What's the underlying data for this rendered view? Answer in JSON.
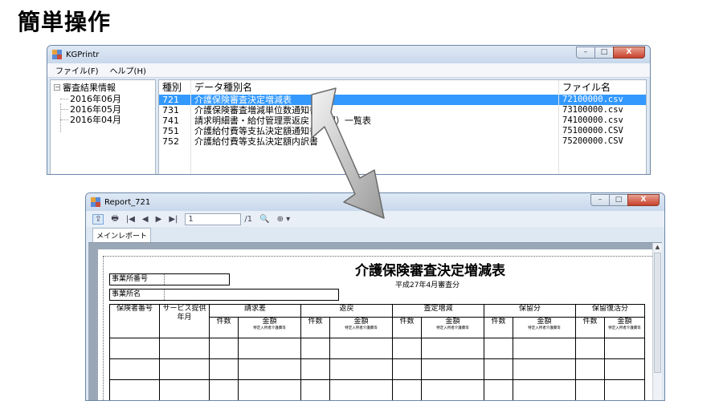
{
  "heading": "簡単操作",
  "main_window": {
    "title": "KGPrintr",
    "controls": {
      "minimize": "–",
      "maximize": "□",
      "close": "X"
    },
    "menu": [
      "ファイル(F)",
      "ヘルプ(H)"
    ],
    "tree": {
      "root": "審査結果情報",
      "expander": "−",
      "children": [
        "2016年06月",
        "2016年05月",
        "2016年04月"
      ]
    },
    "list": {
      "headers": [
        "種別",
        "データ種別名",
        "ファイル名"
      ],
      "rows": [
        {
          "code": "721",
          "name": "介護保険審査決定増減表",
          "file": "72100000.csv",
          "selected": true
        },
        {
          "code": "731",
          "name": "介護保険審査増減単位数通知書",
          "file": "73100000.csv",
          "selected": false
        },
        {
          "code": "741",
          "name": "請求明細書・給付管理票返戻（保留）一覧表",
          "file": "74100000.csv",
          "selected": false
        },
        {
          "code": "751",
          "name": "介護給付費等支払決定額通知書",
          "file": "75100000.CSV",
          "selected": false
        },
        {
          "code": "752",
          "name": "介護給付費等支払決定額内訳書",
          "file": "75200000.CSV",
          "selected": false
        }
      ]
    }
  },
  "report_window": {
    "title": "Report_721",
    "controls": {
      "minimize": "–",
      "maximize": "□",
      "close": "X"
    },
    "toolbar": {
      "page_current": "1",
      "page_total": "/1",
      "binoculars": "🔍",
      "zoom": "⊕ ▾",
      "nav": [
        "|◀",
        "◀",
        "▶",
        "▶|"
      ]
    },
    "tab": "メインレポート",
    "report": {
      "title": "介護保険審査決定増減表",
      "subtitle": "平成27年4月審査分",
      "office_number_label": "事業所番号",
      "office_name_label": "事業所名",
      "col_insurer": "保険者番号",
      "col_service": "サービス提供年月",
      "groups": [
        "請求差",
        "返戻",
        "査定増減",
        "保留分",
        "保留復活分"
      ],
      "count_label": "件数",
      "amount_label": "金額",
      "amount_sub": "特定入所者介護費等"
    }
  },
  "colors": {
    "selection": "#3399ff",
    "title_bar": "#c8d8ec",
    "canvas": "#9aa7b6"
  }
}
